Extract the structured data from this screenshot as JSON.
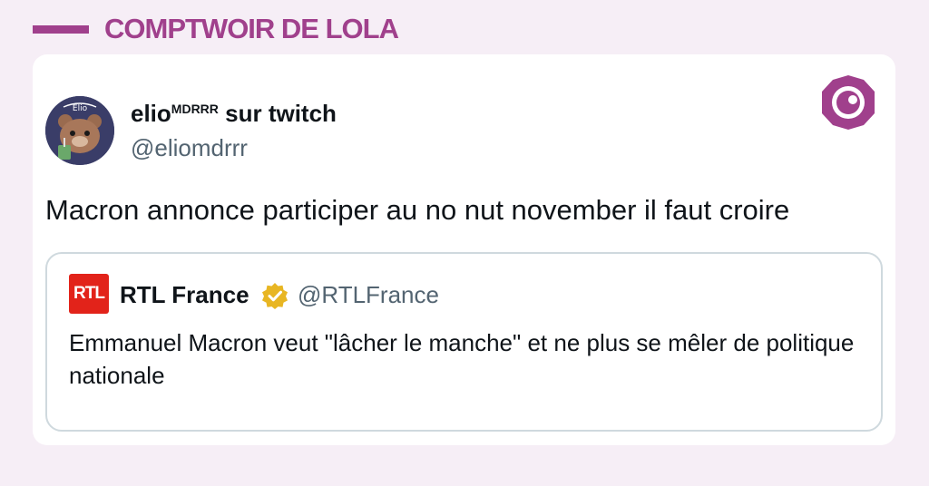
{
  "brand": {
    "name": "COMPTWOIR DE LOLA"
  },
  "tweet": {
    "display_name": "elio",
    "display_name_sup": "MDRRR",
    "display_name_suffix": " sur twitch",
    "handle": "@eliomdrrr",
    "text": "Macron annonce participer au no nut november il faut croire",
    "avatar_label": "Elio"
  },
  "quote": {
    "logo_text": "RTL",
    "name": "RTL France",
    "handle": "@RTLFrance",
    "text": "Emmanuel Macron veut \"lâcher le manche\" et ne plus se mêler de politique nationale"
  },
  "colors": {
    "brand": "#a0408c",
    "page_bg": "#f6eef6",
    "rtl_red": "#e2231a",
    "verified_gold": "#e8b623"
  },
  "icons": {
    "brand_badge": "eye-badge-icon",
    "verified": "verified-badge-icon"
  }
}
